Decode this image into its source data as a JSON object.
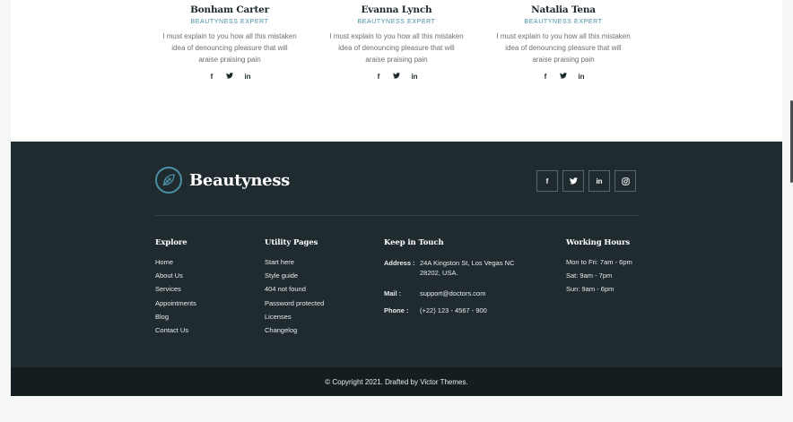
{
  "experts": [
    {
      "name": "Bonham Carter",
      "role": "BEAUTYNESS EXPERT",
      "bio": "I must explain to you how all this mistaken idea of denouncing pleasure that will araise praising pain",
      "social": [
        "f",
        "•",
        "in"
      ]
    },
    {
      "name": "Evanna Lynch",
      "role": "BEAUTYNESS EXPERT",
      "bio": "I must explain to you how all this mistaken idea of denouncing pleasure that will araise praising pain",
      "social": [
        "f",
        "•",
        "in"
      ]
    },
    {
      "name": "Natalia Tena",
      "role": "BEAUTYNESS EXPERT",
      "bio": "I must explain to you how all this mistaken idea of denouncing pleasure that will araise praising pain",
      "social": [
        "f",
        "•",
        "in"
      ]
    }
  ],
  "footer": {
    "brand": "Beautyness",
    "social": [
      {
        "icon": "facebook-icon",
        "glyph": "f"
      },
      {
        "icon": "twitter-icon",
        "glyph": ""
      },
      {
        "icon": "linkedin-icon",
        "glyph": "in"
      },
      {
        "icon": "instagram-icon",
        "glyph": ""
      }
    ],
    "explore": {
      "title": "Explore",
      "items": [
        "Home",
        "About Us",
        "Services",
        "Appointments",
        "Blog",
        "Contact Us"
      ]
    },
    "utility": {
      "title": "Utility Pages",
      "items": [
        "Start here",
        "Style guide",
        "404 not found",
        "Password protected",
        "Licenses",
        "Changelog"
      ]
    },
    "contact": {
      "title": "Keep in Touch",
      "address_label": "Address :",
      "address_value": "24A Kingston St, Los Vegas NC 28202, USA.",
      "mail_label": "Mail :",
      "mail_value": "support@doctors.com",
      "phone_label": "Phone :",
      "phone_value": "(+22) 123 - 4567 - 900"
    },
    "hours": {
      "title": "Working Hours",
      "items": [
        "Mon to Fri: 7am - 6pm",
        "Sat: 9am - 7pm",
        "Sun: 9am - 6pm"
      ]
    },
    "copyright": "© Copyright 2021. Drafted by Victor Themes."
  },
  "colors": {
    "accent": "#4a8fa5",
    "footer_bg": "#1f2b2f",
    "copyright_bg": "#141e21"
  }
}
